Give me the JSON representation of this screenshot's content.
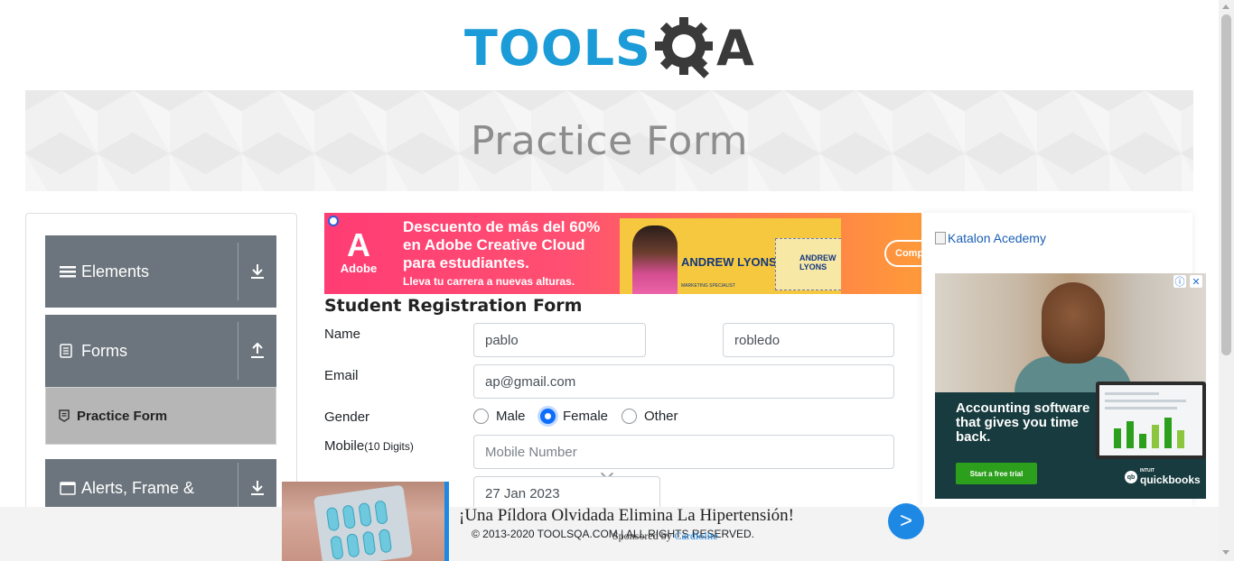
{
  "logo": {
    "tools": "TOOLS",
    "q": "Q",
    "a": "A"
  },
  "banner": {
    "title": "Practice Form"
  },
  "sidebar": {
    "groups": [
      {
        "label": "Elements",
        "arrow": "down"
      },
      {
        "label": "Forms",
        "arrow": "up"
      },
      {
        "label": "Alerts, Frame &",
        "arrow": "down"
      }
    ],
    "active_item": "Practice Form"
  },
  "top_ad": {
    "brand": "Adobe",
    "mark": "A",
    "headline": "Descuento de más del 60% en Adobe Creative Cloud para estudiantes.",
    "sub": "Lleva tu carrera a nuevas alturas.",
    "name": "ANDREW LYONS",
    "role": "MARKETING SPECIALIST",
    "cta": "Compr"
  },
  "form": {
    "title": "Student Registration Form",
    "name_label": "Name",
    "first_name": "pablo",
    "last_name": "robledo",
    "email_label": "Email",
    "email": "ap@gmail.com",
    "gender_label": "Gender",
    "gender_options": [
      "Male",
      "Female",
      "Other"
    ],
    "gender_selected": "Female",
    "mobile_label": "Mobile",
    "mobile_hint": "(10 Digits)",
    "mobile_placeholder": "Mobile Number",
    "dob": "27 Jan 2023"
  },
  "right_ads": {
    "katalon": "Katalon Acedemy",
    "qb_copy": "Accounting software that gives you time back.",
    "qb_cta": "Start a free trial",
    "qb_brand": "quickbooks",
    "qb_intuit": "INTUIT"
  },
  "bottom_ad": {
    "title": "¡Una Píldora Olvidada Elimina La Hipertensión!",
    "sponsored": "Sponsored by",
    "sponsor": "Cardiolite",
    "next": ">"
  },
  "footer": {
    "text": "© 2013-2020 TOOLSQA.COM | ALL RIGHTS RESERVED."
  },
  "colors": {
    "brand_blue": "#1b9bd7",
    "sidebar_gray": "#6c757d",
    "accent_blue": "#1e88e5"
  }
}
